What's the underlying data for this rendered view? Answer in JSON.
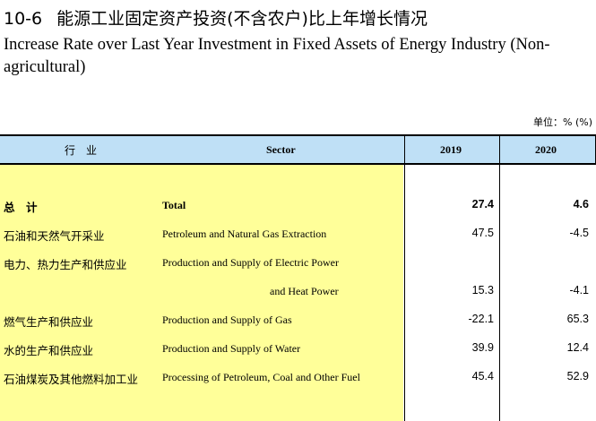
{
  "title": {
    "number": "10-6",
    "cn": "能源工业固定资产投资(不含农户)比上年增长情况",
    "en": "Increase Rate over Last Year Investment in Fixed Assets of Energy Industry (Non-agricultural)"
  },
  "unit": "单位：% (%)",
  "colors": {
    "header_bg": "#bfe0f6",
    "label_bg": "#ffff99"
  },
  "table": {
    "headers": {
      "industry_cn": "行　业",
      "sector_en": "Sector",
      "year1": "2019",
      "year2": "2020"
    },
    "rows": [
      {
        "cn": "总　计",
        "en": "Total",
        "v2019": "27.4",
        "v2020": "4.6"
      },
      {
        "cn": "石油和天然气开采业",
        "en": "Petroleum and Natural Gas Extraction",
        "v2019": "47.5",
        "v2020": "-4.5"
      },
      {
        "cn": "电力、热力生产和供应业",
        "en": "Production and Supply of Electric Power",
        "en2": "and Heat Power",
        "v2019": "15.3",
        "v2020": "-4.1"
      },
      {
        "cn": "燃气生产和供应业",
        "en": "Production and Supply of Gas",
        "v2019": "-22.1",
        "v2020": "65.3"
      },
      {
        "cn": "水的生产和供应业",
        "en": "Production and Supply of Water",
        "v2019": "39.9",
        "v2020": "12.4"
      },
      {
        "cn": "石油煤炭及其他燃料加工业",
        "en": "Processing of Petroleum, Coal and Other Fuel",
        "v2019": "45.4",
        "v2020": "52.9"
      }
    ]
  }
}
